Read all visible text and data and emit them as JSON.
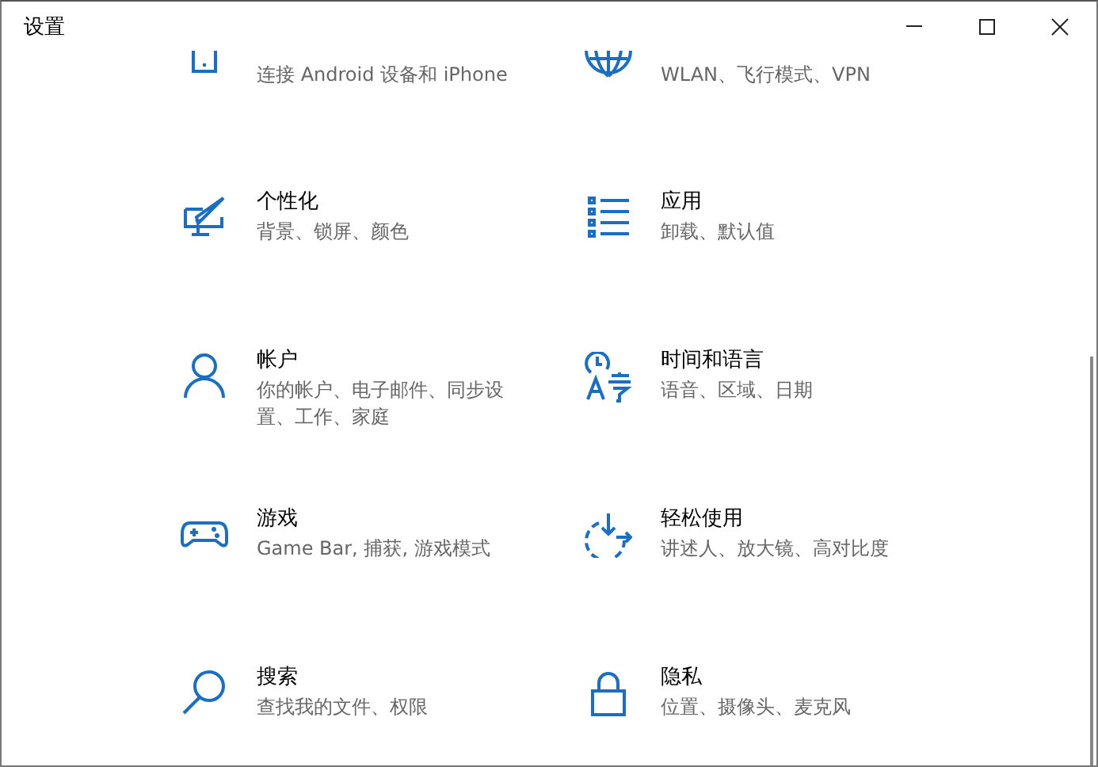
{
  "window": {
    "title": "设置",
    "controls": [
      {
        "kind": "minimize"
      },
      {
        "kind": "maximize"
      },
      {
        "kind": "close"
      }
    ]
  },
  "top_items": [
    {
      "kind": "phone",
      "description": "连接 Android 设备和 iPhone"
    },
    {
      "kind": "globe",
      "description": "WLAN、飞行模式、VPN"
    }
  ],
  "items": [
    {
      "kind": "personalize",
      "title": "个性化",
      "description": "背景、锁屏、颜色"
    },
    {
      "kind": "apps",
      "title": "应用",
      "description": "卸载、默认值"
    },
    {
      "kind": "account",
      "title": "帐户",
      "description": "你的帐户、电子邮件、同步设置、工作、家庭"
    },
    {
      "kind": "time",
      "title": "时间和语言",
      "description": "语音、区域、日期"
    },
    {
      "kind": "gaming",
      "title": "游戏",
      "description": "Game Bar, 捕获, 游戏模式"
    },
    {
      "kind": "ease",
      "title": "轻松使用",
      "description": "讲述人、放大镜、高对比度"
    },
    {
      "kind": "search",
      "title": "搜索",
      "description": "查找我的文件、权限"
    },
    {
      "kind": "privacy",
      "title": "隐私",
      "description": "位置、摄像头、麦克风"
    }
  ]
}
